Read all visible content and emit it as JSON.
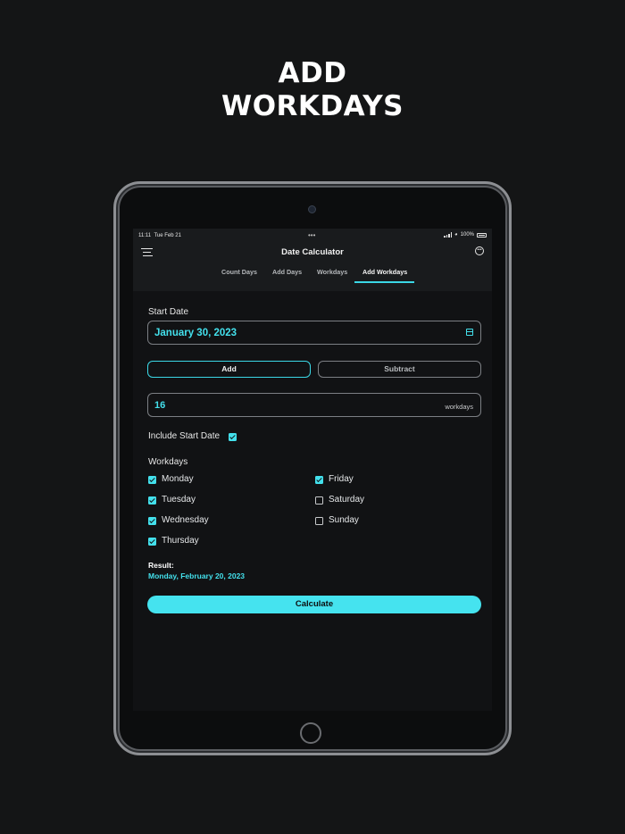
{
  "headline": {
    "line1": "ADD",
    "line2": "WORKDAYS"
  },
  "status_bar": {
    "time": "11:11",
    "date": "Tue Feb 21",
    "dots": "•••",
    "battery": "100%"
  },
  "navbar": {
    "title": "Date Calculator",
    "more_icon": "ellipsis-circle-icon",
    "menu_icon": "hamburger-menu-icon"
  },
  "tabs": [
    {
      "label": "Count Days",
      "active": false
    },
    {
      "label": "Add Days",
      "active": false
    },
    {
      "label": "Workdays",
      "active": false
    },
    {
      "label": "Add Workdays",
      "active": true
    }
  ],
  "form": {
    "start_date_label": "Start Date",
    "start_date_value": "January 30, 2023",
    "add_label": "Add",
    "subtract_label": "Subtract",
    "selected_operation": "Add",
    "amount_value": "16",
    "amount_unit": "workdays",
    "include_start_label": "Include Start Date",
    "include_start_checked": true,
    "workdays_label": "Workdays",
    "days": [
      {
        "label": "Monday",
        "checked": true
      },
      {
        "label": "Tuesday",
        "checked": true
      },
      {
        "label": "Wednesday",
        "checked": true
      },
      {
        "label": "Thursday",
        "checked": true
      },
      {
        "label": "Friday",
        "checked": true
      },
      {
        "label": "Saturday",
        "checked": false
      },
      {
        "label": "Sunday",
        "checked": false
      }
    ],
    "result_title": "Result:",
    "result_value": "Monday, February 20, 2023",
    "calculate_label": "Calculate"
  },
  "colors": {
    "accent": "#43e0ec",
    "background": "#141516",
    "screen": "#111214"
  }
}
